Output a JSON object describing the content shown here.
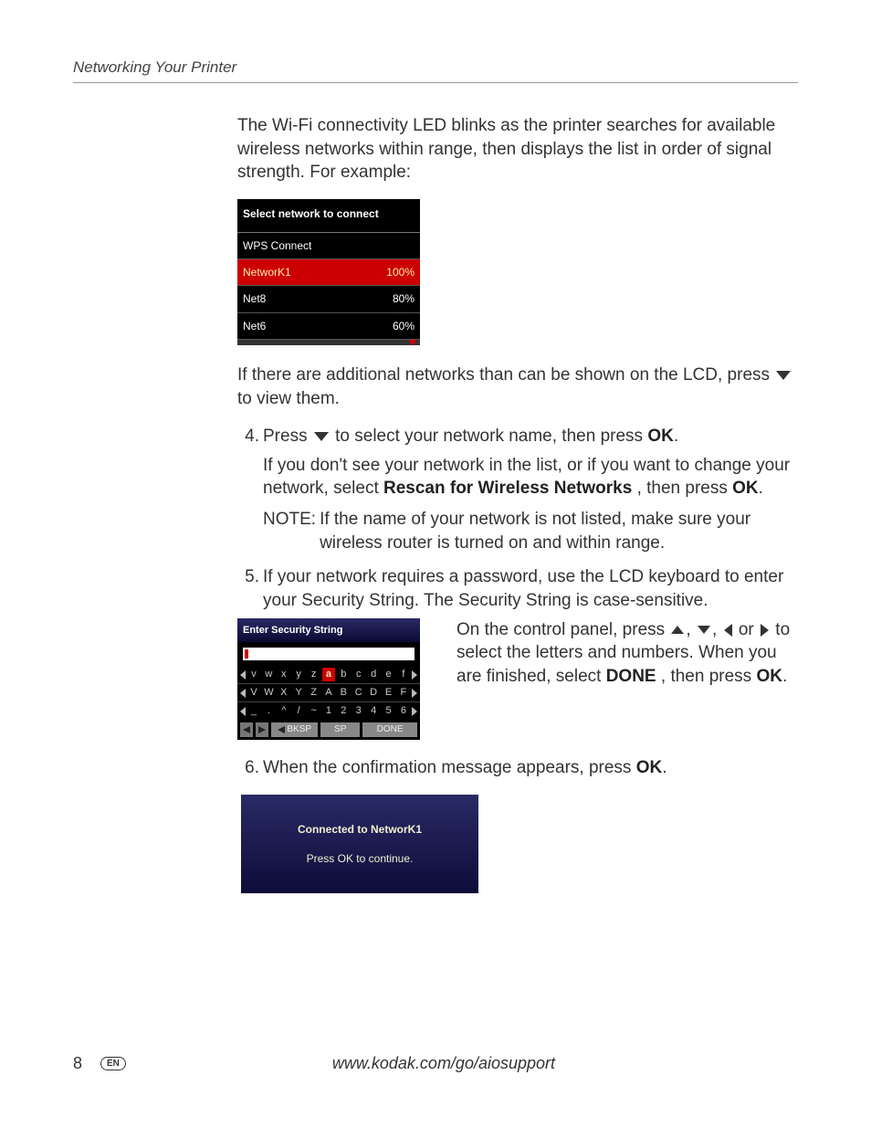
{
  "header": {
    "section_title": "Networking Your Printer"
  },
  "intro": {
    "p1": "The Wi-Fi connectivity LED blinks as the printer searches for available wireless networks within range, then displays the list in order of signal strength. For example:"
  },
  "lcd_networks": {
    "title": "Select network to connect",
    "rows": [
      {
        "name": "WPS Connect",
        "signal": "",
        "selected": false
      },
      {
        "name": "NetworK1",
        "signal": "100%",
        "selected": true
      },
      {
        "name": "Net8",
        "signal": "80%",
        "selected": false
      },
      {
        "name": "Net6",
        "signal": "60%",
        "selected": false
      }
    ]
  },
  "after_list": {
    "p1a": "If there are additional networks than can be shown on the LCD, press ",
    "p1b": " to view them."
  },
  "steps": {
    "s4": {
      "num": "4.",
      "line1a": "Press ",
      "line1b": " to select your network name, then press ",
      "ok": "OK",
      "line1c": ".",
      "line2a": "If you don't see your network in the list, or if you want to change your network, select ",
      "rescan": "Rescan for Wireless Networks",
      "line2b": ", then press ",
      "line2c": ".",
      "note_label": "NOTE:",
      "note_body": "If the name of your network is not listed, make sure your wireless router is turned on and within range."
    },
    "s5": {
      "num": "5.",
      "text": "If your network requires a password, use the LCD keyboard to enter your Security String. The Security String is case-sensitive."
    },
    "s6": {
      "num": "6.",
      "text_a": "When the confirmation message appears, press ",
      "ok": "OK",
      "text_b": "."
    }
  },
  "lcd_keyboard": {
    "title": "Enter Security String",
    "rows": [
      {
        "cells": [
          "v",
          "w",
          "x",
          "y",
          "z",
          "a",
          "b",
          "c",
          "d",
          "e",
          "f"
        ],
        "selected_index": 5
      },
      {
        "cells": [
          "V",
          "W",
          "X",
          "Y",
          "Z",
          "A",
          "B",
          "C",
          "D",
          "E",
          "F"
        ],
        "selected_index": -1
      },
      {
        "cells": [
          "_",
          ".",
          "^",
          "/",
          "~",
          "1",
          "2",
          "3",
          "4",
          "5",
          "6"
        ],
        "selected_index": -1
      }
    ],
    "fn": {
      "bksp": "BKSP",
      "sp": "SP",
      "done": "DONE"
    }
  },
  "keyboard_caption": {
    "a": "On the control panel, press ",
    "comma": ", ",
    "or": " or ",
    "b": " to select the letters and numbers. When you are finished, select ",
    "done": "DONE",
    "c": ", then press ",
    "ok": "OK",
    "d": "."
  },
  "lcd_connected": {
    "l1": "Connected to NetworK1",
    "l2": "Press OK to continue."
  },
  "footer": {
    "page": "8",
    "lang": "EN",
    "url": "www.kodak.com/go/aiosupport"
  }
}
